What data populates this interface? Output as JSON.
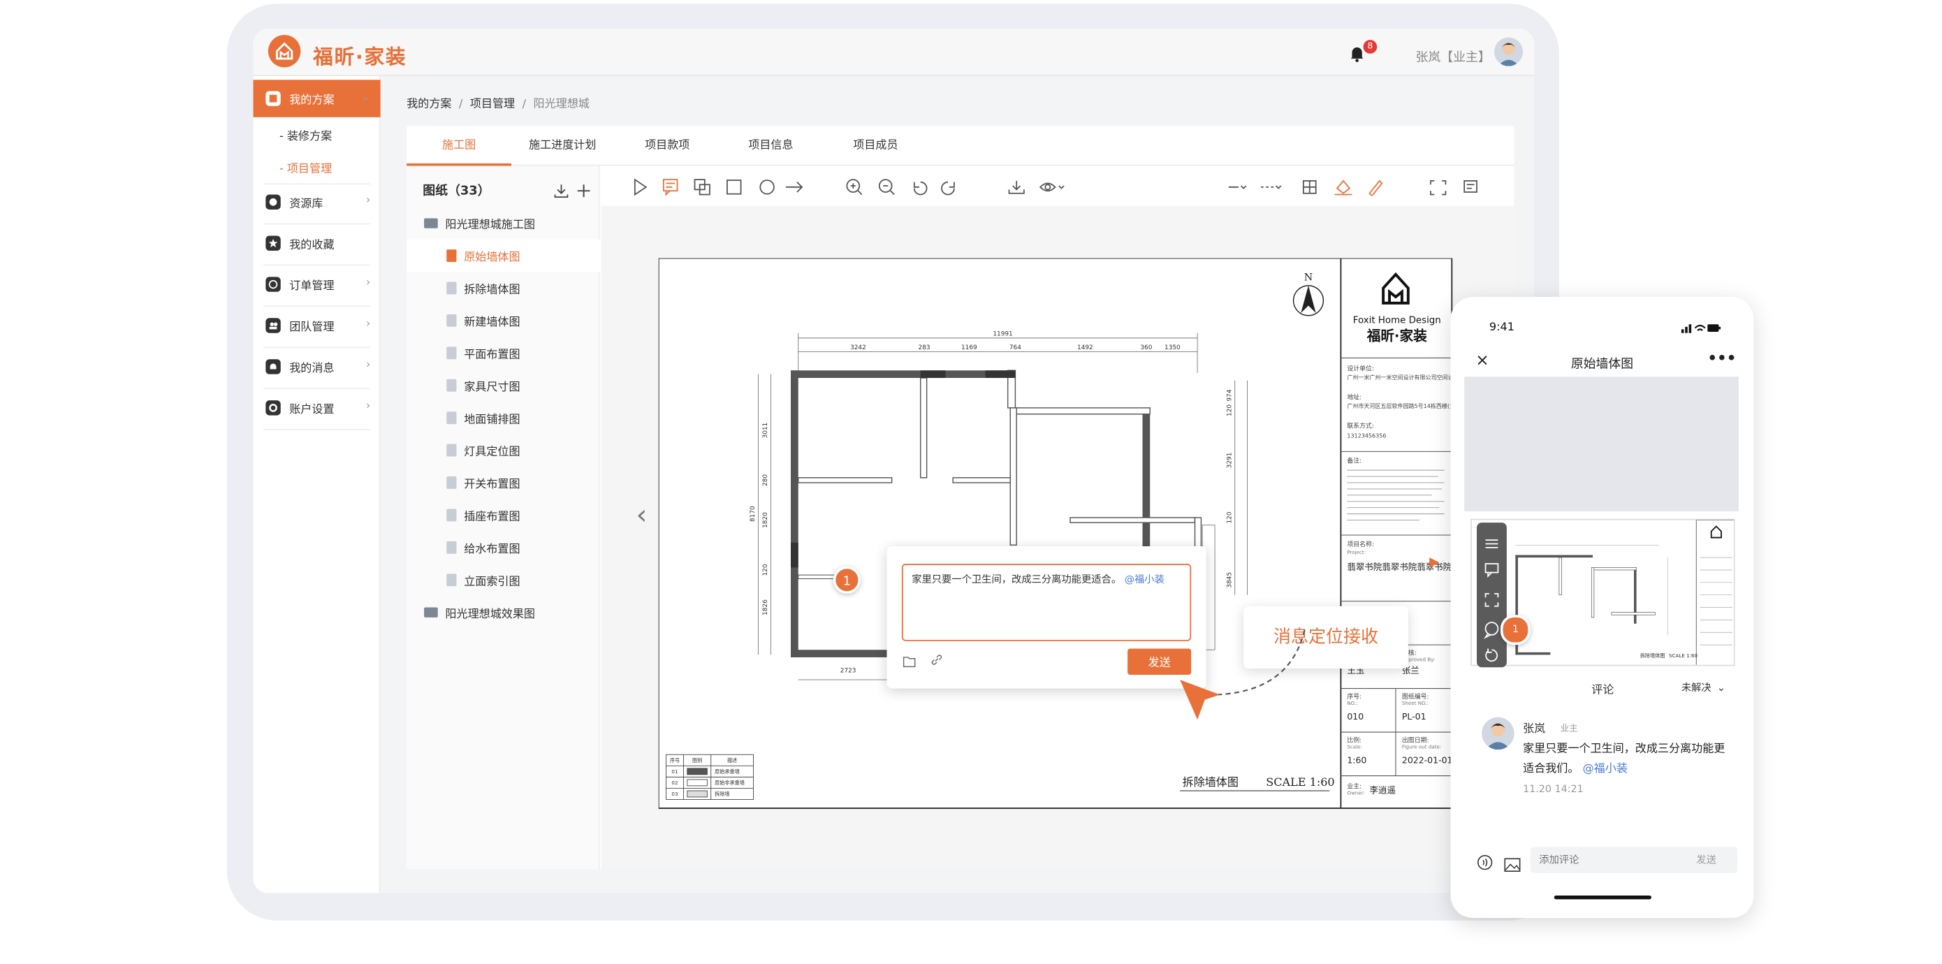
{
  "app": {
    "name": "福昕·家装"
  },
  "header": {
    "notification_count": "8",
    "user_name": "张岚【业主】"
  },
  "sidebar": {
    "items": [
      {
        "label": "我的方案",
        "active": true
      },
      {
        "label": "资源库"
      },
      {
        "label": "我的收藏"
      },
      {
        "label": "订单管理"
      },
      {
        "label": "团队管理"
      },
      {
        "label": "我的消息"
      },
      {
        "label": "账户设置"
      }
    ],
    "sub_items": [
      {
        "label": "- 装修方案"
      },
      {
        "label": "- 项目管理",
        "active": true
      }
    ]
  },
  "breadcrumb": {
    "items": [
      "我的方案",
      "项目管理",
      "阳光理想城"
    ],
    "separator": "/"
  },
  "tabs": [
    {
      "label": "施工图",
      "active": true
    },
    {
      "label": "施工进度计划"
    },
    {
      "label": "项目款项"
    },
    {
      "label": "项目信息"
    },
    {
      "label": "项目成员"
    }
  ],
  "drawings": {
    "title": "图纸（33）",
    "folders": [
      {
        "label": "阳光理想城施工图"
      },
      {
        "label": "阳光理想城效果图"
      }
    ],
    "files": [
      "原始墙体图",
      "拆除墙体图",
      "新建墙体图",
      "平面布置图",
      "家具尺寸图",
      "地面铺排图",
      "灯具定位图",
      "开关布置图",
      "插座布置图",
      "给水布置图",
      "立面索引图"
    ],
    "active_file": "原始墙体图"
  },
  "blueprint": {
    "north": "N",
    "brand_en": "Foxit Home Design",
    "brand_cn": "福昕·家装",
    "dims_top": [
      "11991",
      "3242",
      "283",
      "1169",
      "764",
      "1492",
      "360",
      "1350"
    ],
    "dims_left": [
      "3011",
      "280",
      "1820",
      "120",
      "1826",
      "8170"
    ],
    "dims_right": [
      "974",
      "120",
      "3291",
      "120",
      "3845"
    ],
    "dim_bottom": "2723",
    "design_unit_label": "设计单位:",
    "design_unit": "广州一米广州一米空间设计有限公司空间设计有限公司",
    "address_label": "地址:",
    "address": "广州市天河区五层软件园路5号14栋西楼(天河软件园)2104",
    "contact_label": "联系方式:",
    "contact": "13123456356",
    "notes_label": "备注:",
    "project_label": "项目名称:",
    "project_sub": "Project:",
    "project_name": "翡翠书院翡翠书院翡翠书院-2102",
    "approved_label": "审核:",
    "approved_sub": "Approved By:",
    "approved": "张兰",
    "designer": "王玉",
    "seq_label": "序号:",
    "seq_sub": "NO.:",
    "seq": "010",
    "sheet_label": "图纸编号:",
    "sheet_sub": "Sheet NO.:",
    "sheet_no": "PL-01",
    "scale_label": "比例:",
    "scale_sub": "Scale:",
    "scale": "1:60",
    "date_label": "出图日期:",
    "date_sub": "Figure out date:",
    "date": "2022-01-01",
    "owner_label": "业主:",
    "owner_sub": "Owner:",
    "owner": "李逍遥",
    "drawing_title": "拆除墙体图",
    "drawing_scale": "SCALE 1:60",
    "legend": {
      "headers": [
        "序号",
        "图例",
        "描述"
      ],
      "rows": [
        [
          "01",
          "",
          "原始承重墙"
        ],
        [
          "02",
          "",
          "原始非承重墙"
        ],
        [
          "03",
          "",
          "拆除墙"
        ]
      ]
    }
  },
  "comment_popup": {
    "marker": "1",
    "text": "家里只要一个卫生间，改成三分离功能更适合。",
    "mention": "@福小装",
    "send_label": "发送"
  },
  "callout": {
    "text": "消息定位接收"
  },
  "phone": {
    "time": "9:41",
    "title": "原始墙体图",
    "thumb_marker": "1",
    "comment_title": "评论",
    "filter": "未解决",
    "comment": {
      "user": "张岚",
      "role": "业主",
      "text": "家里只要一个卫生间，改成三分离功能更适合我们。",
      "mention": "@福小装",
      "date": "11.20 14:21"
    },
    "input_placeholder": "添加评论",
    "send_label": "发送"
  },
  "colors": {
    "accent": "#e8713a",
    "mention": "#4a7bd0",
    "wall": "#555555"
  }
}
